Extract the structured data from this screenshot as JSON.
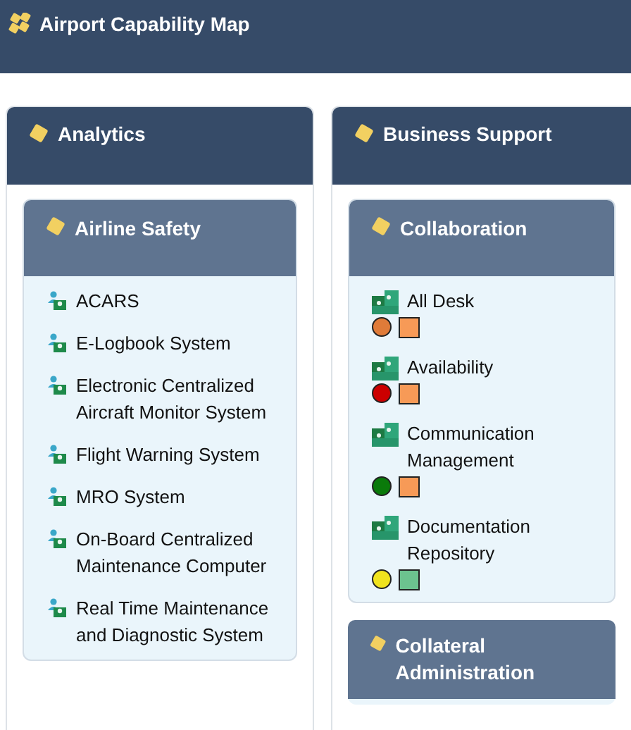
{
  "title": "Airport Capability Map",
  "columns": [
    {
      "title": "Analytics",
      "groups": [
        {
          "title": "Airline Safety",
          "items": [
            {
              "label": "ACARS",
              "kind": "application"
            },
            {
              "label": "E-Logbook System",
              "kind": "application"
            },
            {
              "label": "Electronic Centralized Aircraft Monitor System",
              "kind": "application"
            },
            {
              "label": "Flight Warning System",
              "kind": "application"
            },
            {
              "label": "MRO System",
              "kind": "application"
            },
            {
              "label": "On-Board Centralized Maintenance Computer",
              "kind": "application"
            },
            {
              "label": "Real Time Maintenance and Diagnostic System",
              "kind": "application"
            }
          ]
        }
      ]
    },
    {
      "title": "Business Support",
      "groups": [
        {
          "title": "Collaboration",
          "items": [
            {
              "label": "All Desk",
              "kind": "component",
              "indicators": [
                {
                  "kind": "circle",
                  "color": "#e07b39"
                },
                {
                  "kind": "square",
                  "color": "#f79a57"
                }
              ]
            },
            {
              "label": "Availability",
              "kind": "component",
              "indicators": [
                {
                  "kind": "circle",
                  "color": "#cc0000"
                },
                {
                  "kind": "square",
                  "color": "#f79a57"
                }
              ]
            },
            {
              "label": "Communication Management",
              "kind": "component",
              "indicators": [
                {
                  "kind": "circle",
                  "color": "#0a7a0a"
                },
                {
                  "kind": "square",
                  "color": "#f79a57"
                }
              ]
            },
            {
              "label": "Documentation Repository",
              "kind": "component",
              "indicators": [
                {
                  "kind": "circle",
                  "color": "#f0e31e"
                },
                {
                  "kind": "square",
                  "color": "#6cc38f"
                }
              ]
            }
          ]
        },
        {
          "title": "Collateral Administration"
        }
      ]
    }
  ]
}
